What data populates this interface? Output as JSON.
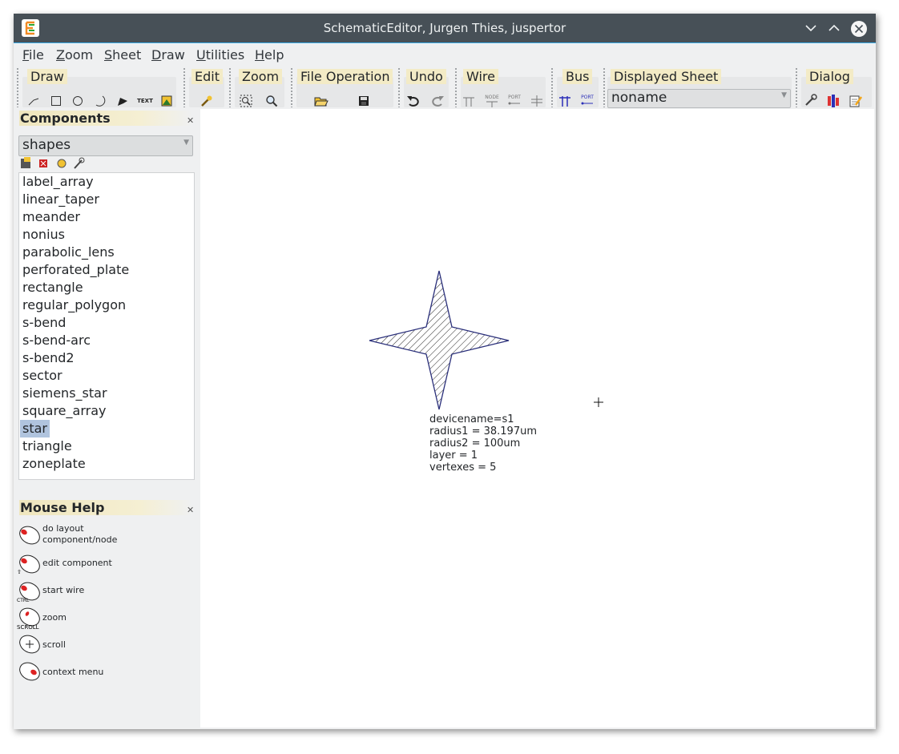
{
  "window": {
    "title": "SchematicEditor, Jurgen Thies, juspertor",
    "app_icon": "schematic-editor-logo"
  },
  "titlebar_buttons": {
    "minimize": "⌄",
    "maximize": "⌃",
    "close": "✕"
  },
  "menu": [
    {
      "label": "File"
    },
    {
      "label": "Zoom"
    },
    {
      "label": "Sheet"
    },
    {
      "label": "Draw"
    },
    {
      "label": "Utilities"
    },
    {
      "label": "Help"
    }
  ],
  "toolbar": {
    "groups": {
      "draw": "Draw",
      "edit": "Edit",
      "zoom": "Zoom",
      "file": "File Operation",
      "undo": "Undo",
      "wire": "Wire",
      "bus": "Bus",
      "sheet": "Displayed Sheet",
      "dialog": "Dialog"
    },
    "text_tool_label": "TEXT",
    "node_label": "NODE",
    "port_label": "PORT",
    "displayed_sheet": "noname"
  },
  "components": {
    "title": "Components",
    "library": "shapes",
    "items": [
      "label_array",
      "linear_taper",
      "meander",
      "nonius",
      "parabolic_lens",
      "perforated_plate",
      "rectangle",
      "regular_polygon",
      "s-bend",
      "s-bend-arc",
      "s-bend2",
      "sector",
      "siemens_star",
      "square_array",
      "star",
      "triangle",
      "zoneplate"
    ],
    "selected": "star"
  },
  "mouse_help": {
    "title": "Mouse Help",
    "entries": [
      {
        "line1": "do layout",
        "line2": "component/node",
        "modifier": ""
      },
      {
        "line1": "edit component",
        "line2": "",
        "modifier": "⇧"
      },
      {
        "line1": "start wire",
        "line2": "",
        "modifier": "CTRL"
      },
      {
        "line1": "zoom",
        "line2": "",
        "modifier": "SCROLL"
      },
      {
        "line1": "scroll",
        "line2": "",
        "modifier": ""
      },
      {
        "line1": "context menu",
        "line2": "",
        "modifier": ""
      }
    ]
  },
  "canvas": {
    "annotation": {
      "devicename": "devicename=s1",
      "radius1": "radius1 = 38.197um",
      "radius2": "radius2 = 100um",
      "layer": "layer = 1",
      "vertexes": "vertexes = 5"
    }
  },
  "colors": {
    "title_bar": "#475057",
    "accent": "#3daee9",
    "selection": "#b0c4de",
    "shape_stroke": "#2a2f7a",
    "group_title_bg": "#f3ebc6"
  }
}
